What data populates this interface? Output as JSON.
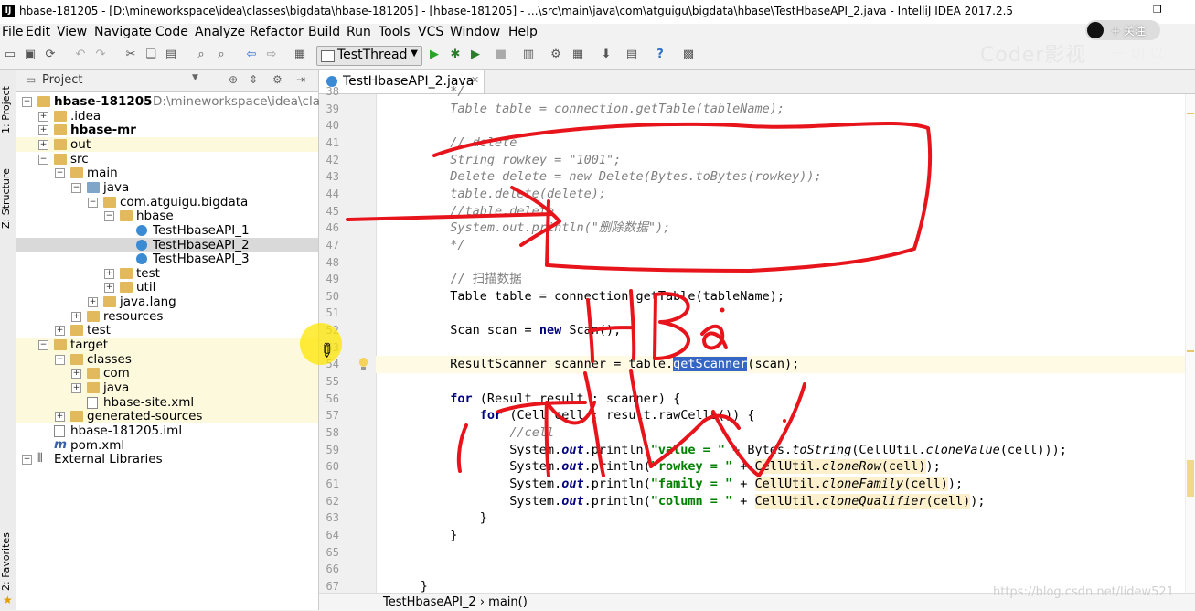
{
  "window": {
    "app_icon": "IJ",
    "title": "hbase-181205 - [D:\\mineworkspace\\idea\\classes\\bigdata\\hbase-181205] - [hbase-181205] - ...\\src\\main\\java\\com\\atguigu\\bigdata\\hbase\\TestHbaseAPI_2.java - IntelliJ IDEA 2017.2.5",
    "restore_icon": "restore-icon"
  },
  "overlay": {
    "follow_label": "+ 关注",
    "watermark": "Coder影视",
    "watermark_extra": "一 切 以"
  },
  "menu": [
    "File",
    "Edit",
    "View",
    "Navigate",
    "Code",
    "Analyze",
    "Refactor",
    "Build",
    "Run",
    "Tools",
    "VCS",
    "Window",
    "Help"
  ],
  "toolbar": {
    "run_config": "TestThread"
  },
  "side_tabs": {
    "project": "1: Project",
    "structure": "Z: Structure",
    "favorites": "2: Favorites"
  },
  "project_panel": {
    "title": "Project",
    "tree": [
      {
        "depth": 0,
        "exp": "-",
        "icon": "folder",
        "label": "hbase-181205",
        "extra": "D:\\mineworkspace\\idea\\clas",
        "bold": true
      },
      {
        "depth": 1,
        "exp": "+",
        "icon": "folder",
        "label": ".idea"
      },
      {
        "depth": 1,
        "exp": "+",
        "icon": "folder",
        "label": "hbase-mr",
        "bold": true
      },
      {
        "depth": 1,
        "exp": "+",
        "icon": "folder",
        "label": "out",
        "hl": true
      },
      {
        "depth": 1,
        "exp": "-",
        "icon": "folder",
        "label": "src"
      },
      {
        "depth": 2,
        "exp": "-",
        "icon": "folder",
        "label": "main"
      },
      {
        "depth": 3,
        "exp": "-",
        "icon": "folder-blue",
        "label": "java"
      },
      {
        "depth": 4,
        "exp": "-",
        "icon": "folder",
        "label": "com.atguigu.bigdata"
      },
      {
        "depth": 5,
        "exp": "-",
        "icon": "folder",
        "label": "hbase"
      },
      {
        "depth": 6,
        "exp": "",
        "icon": "class",
        "label": "TestHbaseAPI_1"
      },
      {
        "depth": 6,
        "exp": "",
        "icon": "class",
        "label": "TestHbaseAPI_2",
        "sel": true
      },
      {
        "depth": 6,
        "exp": "",
        "icon": "class",
        "label": "TestHbaseAPI_3"
      },
      {
        "depth": 5,
        "exp": "+",
        "icon": "folder",
        "label": "test"
      },
      {
        "depth": 5,
        "exp": "+",
        "icon": "folder",
        "label": "util"
      },
      {
        "depth": 4,
        "exp": "+",
        "icon": "folder",
        "label": "java.lang"
      },
      {
        "depth": 3,
        "exp": "+",
        "icon": "folder",
        "label": "resources"
      },
      {
        "depth": 2,
        "exp": "+",
        "icon": "folder",
        "label": "test"
      },
      {
        "depth": 1,
        "exp": "-",
        "icon": "folder",
        "label": "target",
        "hl": true
      },
      {
        "depth": 2,
        "exp": "-",
        "icon": "folder",
        "label": "classes",
        "hl": true
      },
      {
        "depth": 3,
        "exp": "+",
        "icon": "folder",
        "label": "com",
        "hl": true
      },
      {
        "depth": 3,
        "exp": "+",
        "icon": "folder",
        "label": "java",
        "hl": true
      },
      {
        "depth": 3,
        "exp": "",
        "icon": "file",
        "label": "hbase-site.xml",
        "hl": true
      },
      {
        "depth": 2,
        "exp": "+",
        "icon": "folder",
        "label": "generated-sources",
        "hl": true
      },
      {
        "depth": 1,
        "exp": "",
        "icon": "file",
        "label": "hbase-181205.iml"
      },
      {
        "depth": 1,
        "exp": "",
        "icon": "m",
        "label": "pom.xml"
      },
      {
        "depth": 0,
        "exp": "+",
        "icon": "lib",
        "label": "External Libraries"
      }
    ]
  },
  "editor": {
    "tab_label": "TestHbaseAPI_2.java",
    "breadcrumb": "TestHbaseAPI_2  ›  main()",
    "lines": [
      {
        "n": "38",
        "html": "        <span class='cm'>*/</span>"
      },
      {
        "n": "39",
        "html": "        <span class='cm'>Table table = connection.getTable(tableName);</span>"
      },
      {
        "n": "40",
        "html": ""
      },
      {
        "n": "41",
        "html": "        <span class='cm'>// delete</span>"
      },
      {
        "n": "42",
        "html": "        <span class='cm'>String rowkey = \"1001\";</span>"
      },
      {
        "n": "43",
        "html": "        <span class='cm'>Delete delete = new Delete(Bytes.toBytes(rowkey));</span>"
      },
      {
        "n": "44",
        "html": "        <span class='cm'>table.delete(delete);</span>"
      },
      {
        "n": "45",
        "html": "        <span class='cm'>//table.delete</span>"
      },
      {
        "n": "46",
        "html": "        <span class='cm'>System.out.println(\"删除数据\");</span>"
      },
      {
        "n": "47",
        "html": "        <span class='cm'>*/</span>"
      },
      {
        "n": "48",
        "html": ""
      },
      {
        "n": "49",
        "html": "        <span class='cm' style='font-style:normal'>// 扫描数据</span>"
      },
      {
        "n": "50",
        "html": "        Table table = connection.getTable(tableName);"
      },
      {
        "n": "51",
        "html": ""
      },
      {
        "n": "52",
        "html": "        Scan scan = <span class='kw'>new</span> Scan();"
      },
      {
        "n": "53",
        "html": ""
      },
      {
        "n": "54",
        "html": "        ResultScanner scanner = table.<span class='selw'>getScanner</span>(scan);",
        "cur": true
      },
      {
        "n": "55",
        "html": ""
      },
      {
        "n": "56",
        "html": "        <span class='kw'>for</span> (Result result : scanner) {"
      },
      {
        "n": "57",
        "html": "            <span class='kw'>for</span> (Cell cell : result.rawCells()) {"
      },
      {
        "n": "58",
        "html": "                <span class='cm'>//cell</span>"
      },
      {
        "n": "59",
        "html": "                System.<span class='kw it'>out</span>.println(<span class='st'>\"value = \"</span> + Bytes.<span class='it'>toString</span>(CellUtil.<span class='it'>cloneValue</span>(cell)));"
      },
      {
        "n": "60",
        "html": "                System.<span class='kw it'>out</span>.println(<span class='st'>\"rowkey = \"</span> + <span class='ref'>CellUtil.<span class='it'>cloneRow</span>(cell)</span>);"
      },
      {
        "n": "61",
        "html": "                System.<span class='kw it'>out</span>.println(<span class='st'>\"family = \"</span> + <span class='ref'>CellUtil.<span class='it'>cloneFamily</span>(cell)</span>);"
      },
      {
        "n": "62",
        "html": "                System.<span class='kw it'>out</span>.println(<span class='st'>\"column = \"</span> + <span class='ref'>CellUtil.<span class='it'>cloneQualifier</span>(cell)</span>);"
      },
      {
        "n": "63",
        "html": "            }"
      },
      {
        "n": "64",
        "html": "        }"
      },
      {
        "n": "65",
        "html": ""
      },
      {
        "n": "66",
        "html": ""
      },
      {
        "n": "67",
        "html": "    }"
      }
    ]
  },
  "footer": {
    "csdn": "https://blog.csdn.net/lidew521"
  },
  "colors": {
    "annotation_ink": "#e8141b",
    "selection": "#3565c5",
    "highlight_row": "#fcf9dc",
    "current_line": "#fffae3"
  }
}
